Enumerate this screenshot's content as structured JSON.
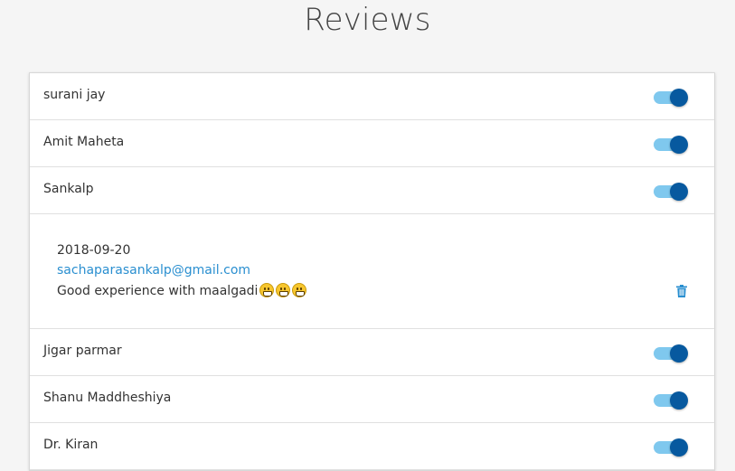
{
  "header": {
    "title": "Reviews"
  },
  "reviews": [
    {
      "name": "surani jay",
      "enabled": true
    },
    {
      "name": "Amit Maheta",
      "enabled": true
    },
    {
      "name": "Sankalp",
      "enabled": true
    },
    {
      "name": "Jigar parmar",
      "enabled": true
    },
    {
      "name": "Shanu Maddheshiya",
      "enabled": true
    },
    {
      "name": "Dr. Kiran",
      "enabled": true
    }
  ],
  "expanded": {
    "date": "2018-09-20",
    "email": "sachaparasankalp@gmail.com",
    "comment": "Good experience with maalgadi",
    "emoji_count": 3,
    "delete_icon": "trash-icon"
  },
  "colors": {
    "toggle_track": "#7fc8ee",
    "toggle_knob": "#07599f",
    "link": "#2a8fd0"
  }
}
